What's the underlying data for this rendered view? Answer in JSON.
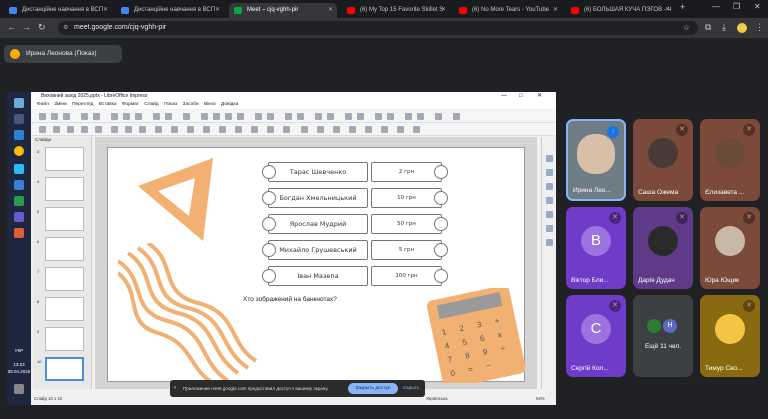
{
  "browser": {
    "tabs": [
      {
        "label": "Дистанційне навчання в ВСП",
        "color": "#4285f4"
      },
      {
        "label": "Дистанційне навчання в ВСП",
        "color": "#4285f4"
      },
      {
        "label": "Meet – cjq-vghh-pir",
        "color": "#00ac47"
      },
      {
        "label": "(6) My Top 15 Favorite Skillet S",
        "color": "#ff0000"
      },
      {
        "label": "(6) No More Tears - YouTube",
        "color": "#ff0000"
      },
      {
        "label": "(6) БОЛЬШАЯ КУЧА ПЭГОВ - Ч",
        "color": "#ff0000"
      }
    ],
    "new_tab": "+",
    "url": "meet.google.com/cjq-vghh-pir"
  },
  "meet": {
    "presenter_label": "Ирина Леонова (Показ)"
  },
  "windows": {
    "lang": "УКР",
    "time": "13:23",
    "date": "08.04.2025"
  },
  "impress": {
    "title": "Виховний захід 2025.pptx - LibreOffice Impress",
    "menu": [
      "Файл",
      "Зміни",
      "Перегляд",
      "Вставка",
      "Формат",
      "Слайд",
      "Показ",
      "Засоби",
      "Вікно",
      "Довідка"
    ],
    "slides_label": "Слайди",
    "thumb_numbers": [
      "3",
      "4",
      "5",
      "6",
      "7",
      "8",
      "9",
      "10"
    ],
    "status_left": "Слайд 10 з 10",
    "status_lang": "Українська",
    "zoom": "54%",
    "slide": {
      "rows": [
        {
          "name": "Тарас Шевченко",
          "price": "2 грн"
        },
        {
          "name": "Богдан Хмельницький",
          "price": "10 грн"
        },
        {
          "name": "Ярослав Мудрий",
          "price": "50 грн"
        },
        {
          "name": "Михайло Грушевський",
          "price": "5 грн"
        },
        {
          "name": "Іван Мазепа",
          "price": "100 грн"
        }
      ],
      "question": "Хто зображений на банкнотах?",
      "calc_keys": [
        "1",
        "2",
        "3",
        "+",
        "4",
        "5",
        "6",
        "x",
        "7",
        "8",
        "9",
        "÷",
        "0",
        "=",
        "−"
      ]
    },
    "share_notice": {
      "text": "Приложение meet.google.com предоставил доступ к вашему экрану.",
      "button": "Закрыть доступ",
      "link": "Скрыть"
    }
  },
  "participants": [
    {
      "name": "Ирина Лео...",
      "initial": "",
      "color": "#6e7c86",
      "mic": "on"
    },
    {
      "name": "Саша Ожема",
      "initial": "",
      "color": "#7b4a3a",
      "mic": "off"
    },
    {
      "name": "Єлизавета ...",
      "initial": "",
      "color": "#7b4a3a",
      "mic": "off"
    },
    {
      "name": "Віктор Бли...",
      "initial": "В",
      "color": "#6f3cc9",
      "mic": "off"
    },
    {
      "name": "Дарія Дудач",
      "initial": "",
      "color": "#5e3a88",
      "mic": "off"
    },
    {
      "name": "Юра Ющик",
      "initial": "",
      "color": "#7b4a3a",
      "mic": "off"
    },
    {
      "name": "Сергій Кол...",
      "initial": "С",
      "color": "#6f3cc9",
      "mic": "off"
    },
    {
      "name": "Ещё 11 чел.",
      "initial": "Н",
      "color": "#3c4043",
      "mic": "none"
    },
    {
      "name": "Тимур Сво...",
      "initial": "",
      "color": "#8a6a10",
      "mic": "off"
    }
  ]
}
